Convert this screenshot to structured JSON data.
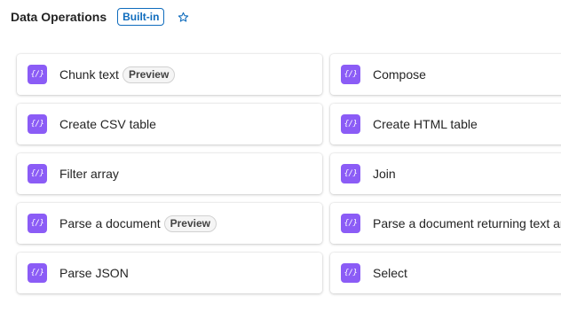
{
  "header": {
    "title": "Data Operations",
    "badge": "Built-in",
    "favorite_icon": "star-outline-icon"
  },
  "actions": [
    {
      "label": "Chunk text",
      "badge": "Preview"
    },
    {
      "label": "Compose",
      "badge": ""
    },
    {
      "label": "Create CSV table",
      "badge": ""
    },
    {
      "label": "Create HTML table",
      "badge": ""
    },
    {
      "label": "Filter array",
      "badge": ""
    },
    {
      "label": "Join",
      "badge": ""
    },
    {
      "label": "Parse a document",
      "badge": "Preview"
    },
    {
      "label": "Parse a document returning text and",
      "badge": ""
    },
    {
      "label": "Parse JSON",
      "badge": ""
    },
    {
      "label": "Select",
      "badge": ""
    }
  ],
  "icon": {
    "name": "data-operation-icon",
    "glyph": "{/}",
    "color": "#8b5cf6"
  },
  "colors": {
    "accent": "#0f6cbd",
    "icon_bg": "#8b5cf6"
  }
}
